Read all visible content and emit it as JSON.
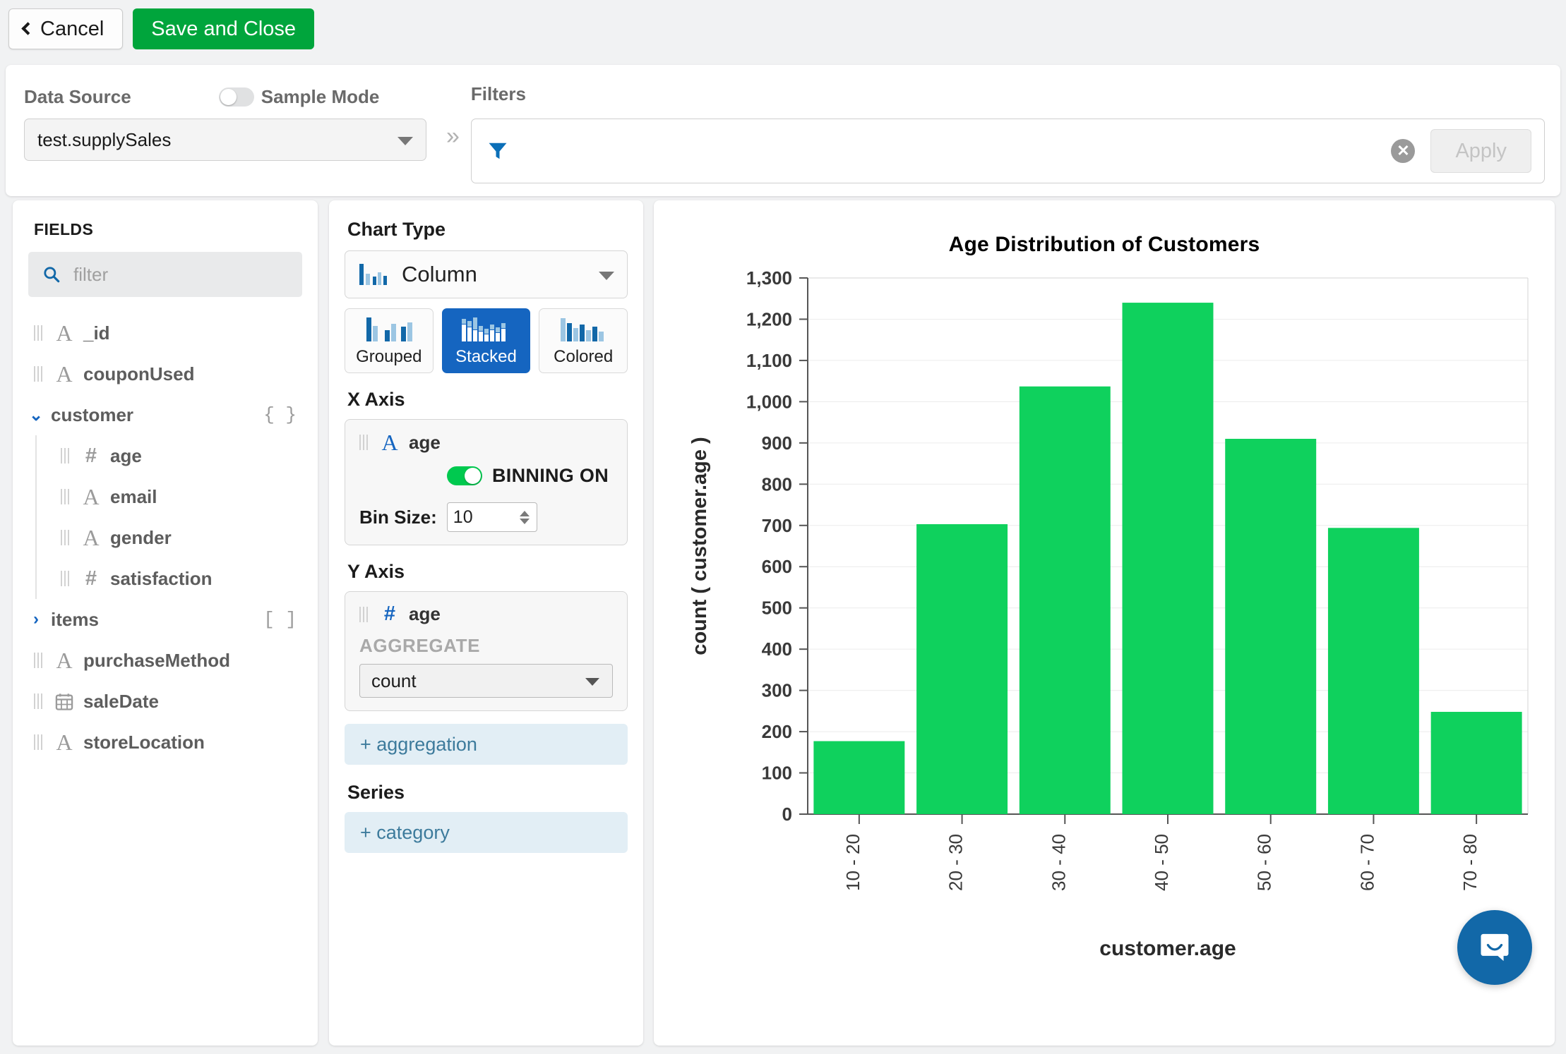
{
  "topbar": {
    "cancel_label": "Cancel",
    "save_label": "Save and Close"
  },
  "datasource": {
    "label": "Data Source",
    "sample_mode_label": "Sample Mode",
    "sample_mode_on": false,
    "value": "test.supplySales"
  },
  "filters": {
    "label": "Filters",
    "value": "",
    "placeholder": "",
    "apply_label": "Apply"
  },
  "fields": {
    "title": "FIELDS",
    "search_placeholder": "filter",
    "search_value": "",
    "items": [
      {
        "label": "_id",
        "type": "string",
        "icon": "text-type-icon",
        "depth": 0
      },
      {
        "label": "couponUsed",
        "type": "string",
        "icon": "text-type-icon",
        "depth": 0
      },
      {
        "label": "customer",
        "type": "object",
        "icon": "chevron-down-icon",
        "badge": "{ }",
        "expanded": true,
        "depth": 0
      },
      {
        "label": "age",
        "type": "number",
        "icon": "number-type-icon",
        "depth": 1
      },
      {
        "label": "email",
        "type": "string",
        "icon": "text-type-icon",
        "depth": 1
      },
      {
        "label": "gender",
        "type": "string",
        "icon": "text-type-icon",
        "depth": 1
      },
      {
        "label": "satisfaction",
        "type": "number",
        "icon": "number-type-icon",
        "depth": 1
      },
      {
        "label": "items",
        "type": "array",
        "icon": "chevron-right-icon",
        "badge": "[ ]",
        "expanded": false,
        "depth": 0
      },
      {
        "label": "purchaseMethod",
        "type": "string",
        "icon": "text-type-icon",
        "depth": 0
      },
      {
        "label": "saleDate",
        "type": "date",
        "icon": "calendar-icon",
        "depth": 0
      },
      {
        "label": "storeLocation",
        "type": "string",
        "icon": "text-type-icon",
        "depth": 0
      }
    ]
  },
  "builder": {
    "chart_type_label": "Chart Type",
    "chart_type_value": "Column",
    "variants": [
      {
        "label": "Grouped",
        "active": false
      },
      {
        "label": "Stacked",
        "active": true
      },
      {
        "label": "Colored",
        "active": false
      }
    ],
    "x_axis": {
      "title": "X Axis",
      "field": "age",
      "field_type": "string",
      "binning_label": "BINNING ON",
      "binning_on": true,
      "bin_size_label": "Bin Size:",
      "bin_size_value": "10"
    },
    "y_axis": {
      "title": "Y Axis",
      "field": "age",
      "field_type": "number",
      "aggregate_label": "AGGREGATE",
      "aggregate_value": "count"
    },
    "add_aggregation_label": "+ aggregation",
    "series_title": "Series",
    "add_category_label": "+ category"
  },
  "chart_data": {
    "type": "bar",
    "title": "Age Distribution of Customers",
    "xlabel": "customer.age",
    "ylabel": "count ( customer.age )",
    "categories": [
      "10 - 20",
      "20 - 30",
      "30 - 40",
      "40 - 50",
      "50 - 60",
      "60 - 70",
      "70 - 80"
    ],
    "values": [
      177,
      703,
      1037,
      1240,
      910,
      694,
      248
    ],
    "ylim": [
      0,
      1300
    ],
    "ytick_step": 100,
    "ytick_labels": [
      "0",
      "100",
      "200",
      "300",
      "400",
      "500",
      "600",
      "700",
      "800",
      "900",
      "1,000",
      "1,100",
      "1,200",
      "1,300"
    ],
    "bar_color": "#0fd15d",
    "grid": true,
    "legend": false,
    "series": [
      {
        "name": "count ( customer.age )",
        "values": [
          177,
          703,
          1037,
          1240,
          910,
          694,
          248
        ]
      }
    ]
  },
  "chat": {
    "label": "open-chat"
  },
  "colors": {
    "accent_blue": "#1565c0",
    "save_green": "#00a53c",
    "bar_green": "#0fd15d",
    "chat_blue": "#1268a8"
  }
}
